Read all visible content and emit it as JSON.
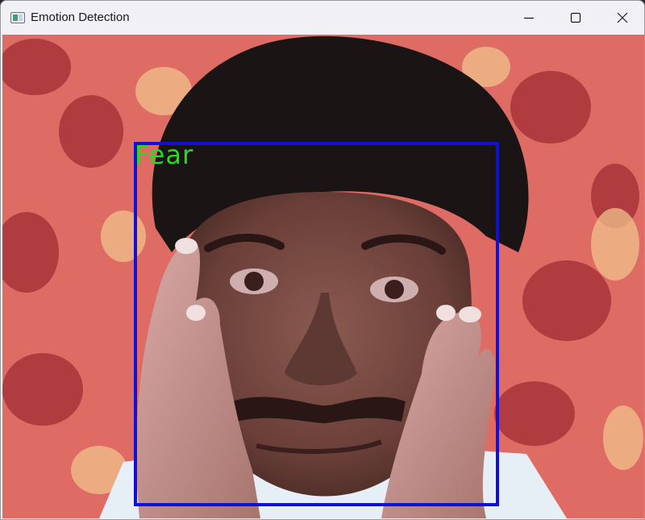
{
  "window": {
    "title": "Emotion Detection",
    "icon": "app-window-icon"
  },
  "controls": {
    "minimize_icon": "minimize-icon",
    "maximize_icon": "maximize-icon",
    "close_icon": "close-icon"
  },
  "detection": {
    "label": "Fear",
    "label_color": "#22e01c",
    "box_color": "#1010d8"
  }
}
